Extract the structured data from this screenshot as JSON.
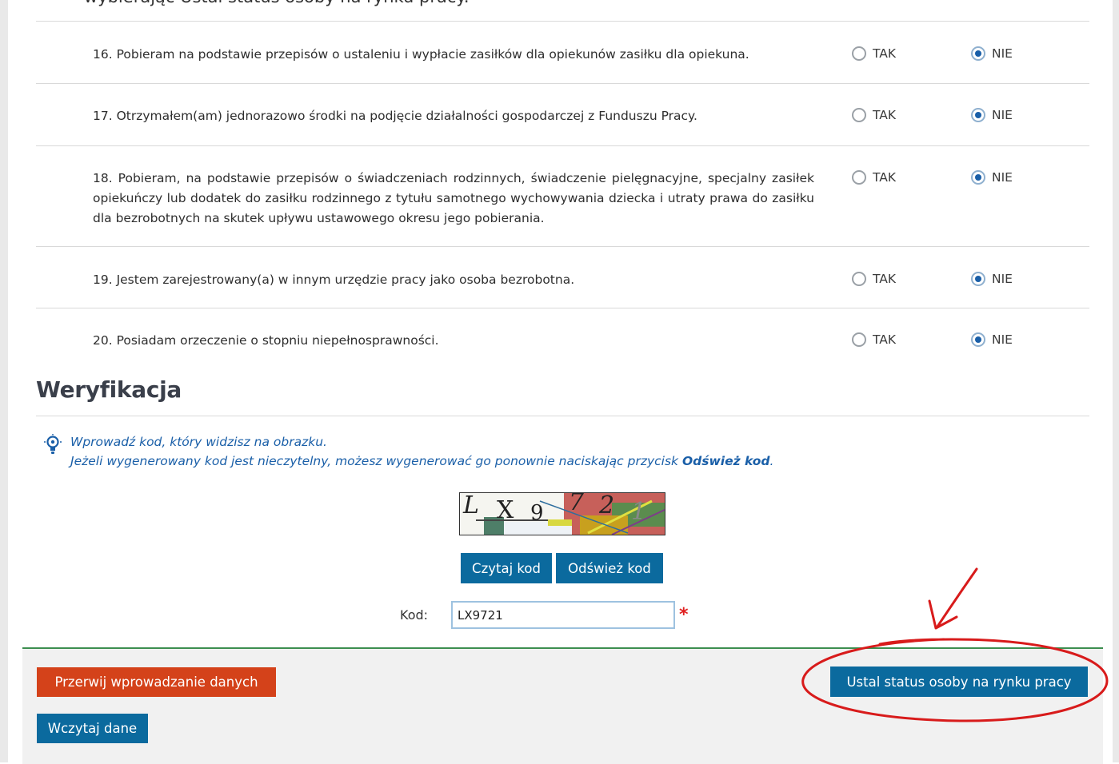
{
  "top_text": "wybierając Ustal status osoby na rynku pracy.",
  "questions": [
    {
      "text": "16. Pobieram na podstawie przepisów o ustaleniu i wypłacie zasiłków dla opiekunów zasiłku dla opiekuna.",
      "yes": "TAK",
      "no": "NIE",
      "selected": "NIE"
    },
    {
      "text": "17. Otrzymałem(am) jednorazowo środki na podjęcie działalności gospodarczej z Funduszu Pracy.",
      "yes": "TAK",
      "no": "NIE",
      "selected": "NIE"
    },
    {
      "text": "18. Pobieram, na podstawie przepisów o świadczeniach rodzinnych, świadczenie pielęgnacyjne, specjalny zasiłek opiekuńczy lub dodatek do zasiłku rodzinnego z tytułu samotnego wychowywania dziecka i utraty prawa do zasiłku dla bezrobotnych na skutek upływu ustawowego okresu jego pobierania.",
      "yes": "TAK",
      "no": "NIE",
      "selected": "NIE"
    },
    {
      "text": "19. Jestem zarejestrowany(a) w innym urzędzie pracy jako osoba bezrobotna.",
      "yes": "TAK",
      "no": "NIE",
      "selected": "NIE"
    },
    {
      "text": "20. Posiadam orzeczenie o stopniu niepełnosprawności.",
      "yes": "TAK",
      "no": "NIE",
      "selected": "NIE"
    }
  ],
  "verification": {
    "heading": "Weryfikacja",
    "hint_line1": "Wprowadź kod, który widzisz na obrazku.",
    "hint_line2_pre": "Jeżeli wygenerowany kod jest nieczytelny, możesz wygenerować go ponownie naciskając przycisk ",
    "hint_line2_bold": "Odśwież kod",
    "hint_line2_post": ".",
    "captcha_chars": [
      "L",
      "X",
      "9",
      "7",
      "2",
      "1"
    ],
    "read_button": "Czytaj kod",
    "refresh_button": "Odśwież kod",
    "code_label": "Kod:",
    "code_value": "LX9721",
    "required_mark": "*"
  },
  "footer": {
    "abort_button": "Przerwij wprowadzanie danych",
    "load_button": "Wczytaj dane",
    "status_button": "Ustal status osoby na rynku pracy"
  },
  "colors": {
    "primary": "#0b6a9e",
    "danger": "#d4421a",
    "annotation": "#d81b1b",
    "footer_border": "#3c8e4f"
  }
}
